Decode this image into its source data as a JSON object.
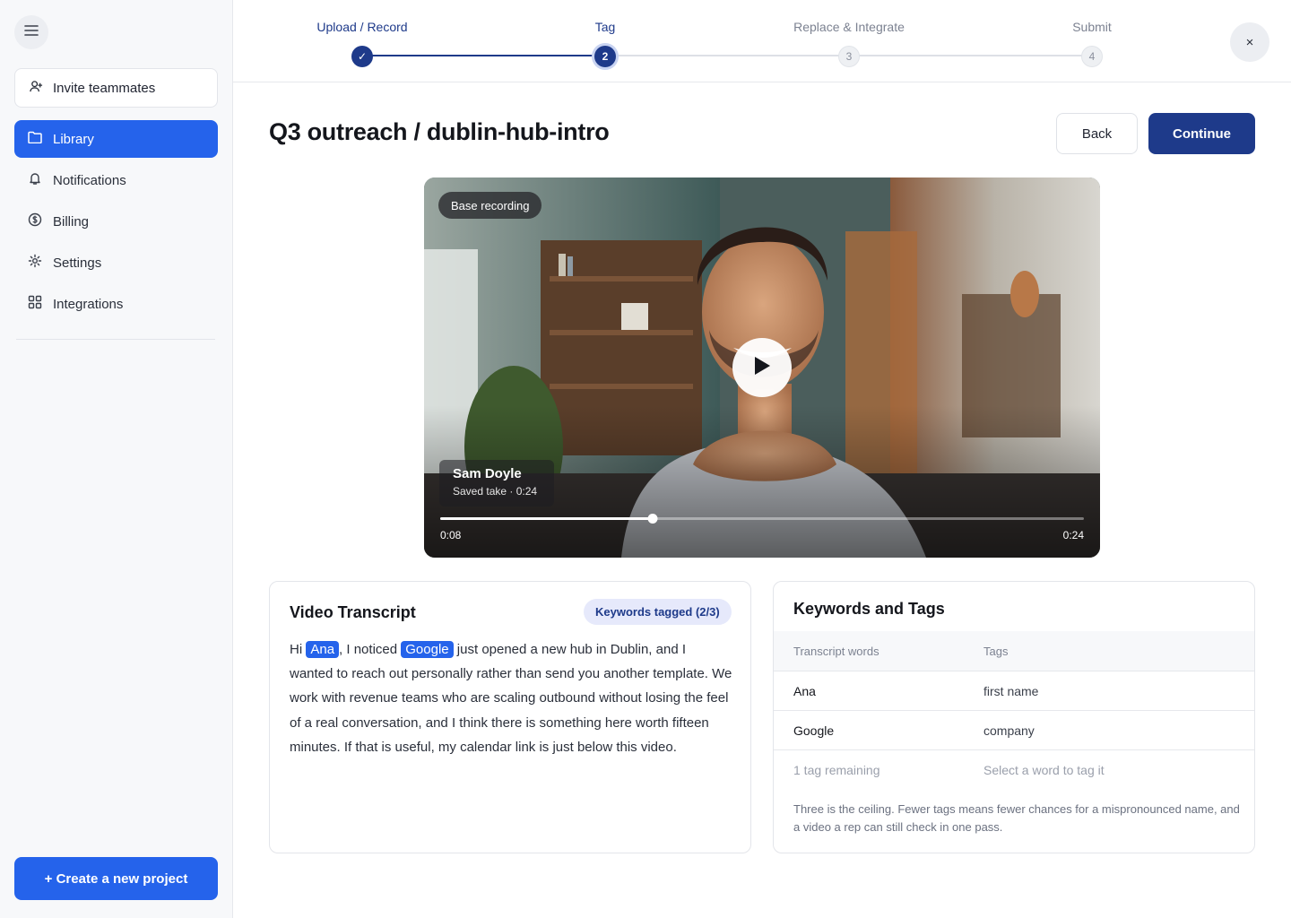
{
  "sidebar": {
    "invite_label": "Invite teammates",
    "items": [
      {
        "label": "Library",
        "icon": "folder-icon"
      },
      {
        "label": "Notifications",
        "icon": "bell-icon"
      },
      {
        "label": "Billing",
        "icon": "dollar-circle-icon"
      },
      {
        "label": "Settings",
        "icon": "gear-icon"
      },
      {
        "label": "Integrations",
        "icon": "grid-icon"
      }
    ],
    "create_label": "+ Create a new project"
  },
  "stepper": {
    "steps": [
      {
        "label": "Upload / Record",
        "marker": "✓",
        "state": "done"
      },
      {
        "label": "Tag",
        "marker": "2",
        "state": "current"
      },
      {
        "label": "Replace & Integrate",
        "marker": "3",
        "state": "todo"
      },
      {
        "label": "Submit",
        "marker": "4",
        "state": "todo"
      }
    ],
    "close_label": "×"
  },
  "header": {
    "title": "Q3 outreach / dublin-hub-intro",
    "back_label": "Back",
    "continue_label": "Continue"
  },
  "video": {
    "badge": "Base recording",
    "speaker_name": "Sam Doyle",
    "speaker_meta": "Saved take · 0:24",
    "current_time": "0:08",
    "duration": "0:24",
    "progress": 0.33
  },
  "transcript": {
    "title": "Video Transcript",
    "badge": "Keywords tagged (2/3)",
    "segments": {
      "s1": "Hi ",
      "k1": "Ana",
      "s2": ", I noticed ",
      "k2": "Google",
      "s3": " just opened a new hub in Dublin, and I wanted to reach out personally rather than send you another template. We work with revenue teams who are scaling outbound without losing the feel of a real conversation, and I think there is something here worth fifteen minutes. If that is useful, my calendar link is just below this video."
    }
  },
  "keywords": {
    "title": "Keywords and Tags",
    "col_words": "Transcript words",
    "col_tags": "Tags",
    "rows": [
      {
        "word": "Ana",
        "tag": "first name"
      },
      {
        "word": "Google",
        "tag": "company"
      }
    ],
    "remaining_label": "1 tag remaining",
    "select_hint": "Select a word to tag it",
    "note": "Three is the ceiling. Fewer tags means fewer chances for a mispronounced name, and a video a rep can still check in one pass."
  },
  "colors": {
    "accent": "#2563eb",
    "navy": "#1e3a8a"
  }
}
